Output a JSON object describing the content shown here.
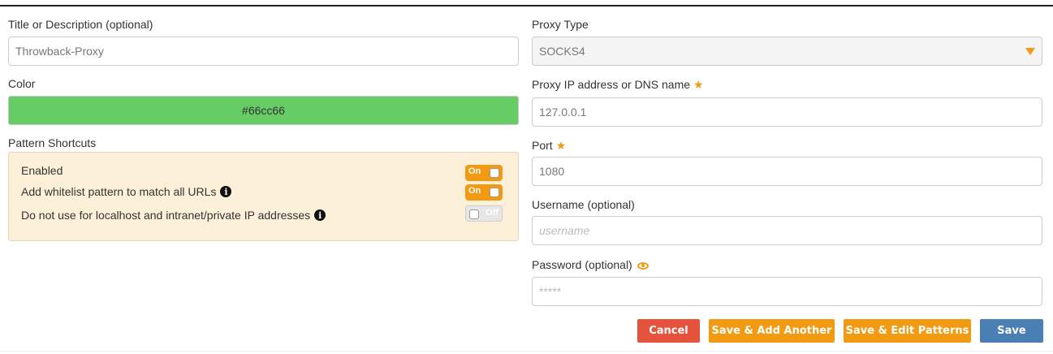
{
  "left": {
    "title_label": "Title or Description (optional)",
    "title_value": "Throwback-Proxy",
    "color_label": "Color",
    "color_value": "#66cc66",
    "shortcuts_label": "Pattern Shortcuts",
    "shortcuts": [
      {
        "label": "Enabled",
        "state": "On",
        "on": true,
        "info": false
      },
      {
        "label": "Add whitelist pattern to match all URLs",
        "state": "On",
        "on": true,
        "info": true
      },
      {
        "label": "Do not use for localhost and intranet/private IP addresses",
        "state": "Off",
        "on": false,
        "info": true
      }
    ]
  },
  "right": {
    "proxy_type_label": "Proxy Type",
    "proxy_type_value": "SOCKS4",
    "ip_label": "Proxy IP address or DNS name",
    "ip_value": "127.0.0.1",
    "port_label": "Port",
    "port_value": "1080",
    "username_label": "Username (optional)",
    "username_placeholder": "username",
    "password_label": "Password (optional)",
    "password_placeholder": "*****"
  },
  "buttons": {
    "cancel": "Cancel",
    "save_add": "Save & Add Another",
    "save_edit": "Save & Edit Patterns",
    "save": "Save"
  },
  "colors": {
    "accent": "#f29a12",
    "danger": "#e5533d",
    "primary": "#4a7fb5",
    "shortcuts_bg": "#fdf0d9"
  }
}
